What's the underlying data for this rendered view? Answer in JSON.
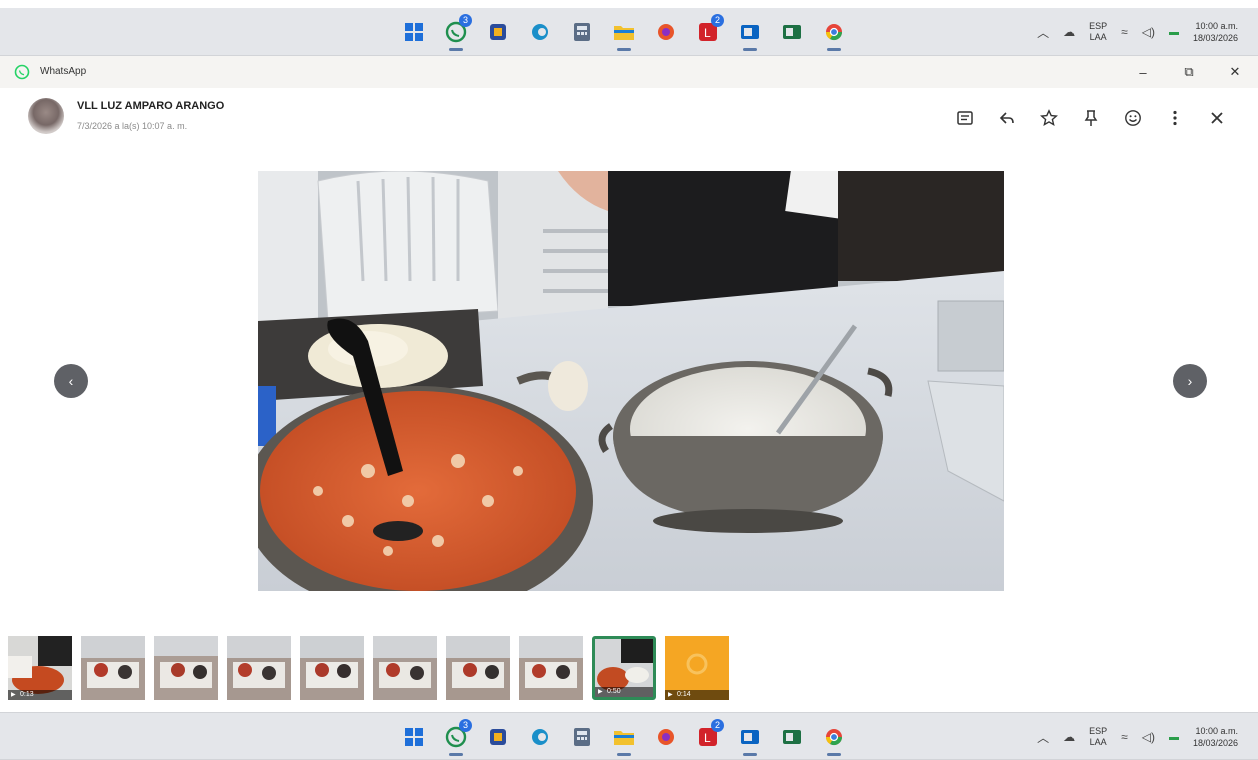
{
  "taskbar": {
    "apps": [
      {
        "icon": "windows-start-icon",
        "badge": "",
        "active": false
      },
      {
        "icon": "whatsapp-icon",
        "badge": "3",
        "active": true
      },
      {
        "icon": "store-app-icon",
        "badge": "",
        "active": false
      },
      {
        "icon": "edge-browser-icon",
        "badge": "",
        "active": false
      },
      {
        "icon": "calculator-icon",
        "badge": "",
        "active": false
      },
      {
        "icon": "file-explorer-icon",
        "badge": "",
        "active": true
      },
      {
        "icon": "firefox-icon",
        "badge": "",
        "active": false
      },
      {
        "icon": "red-app-icon",
        "badge": "2",
        "active": false
      },
      {
        "icon": "outlook-icon",
        "badge": "",
        "active": true
      },
      {
        "icon": "excel-icon",
        "badge": "",
        "active": false
      },
      {
        "icon": "chrome-icon",
        "badge": "",
        "active": true
      }
    ],
    "language": {
      "line1": "ESP",
      "line2": "LAA"
    },
    "clock": {
      "time": "10:00 a.m.",
      "date": "18/03/2026"
    }
  },
  "window": {
    "title": "WhatsApp",
    "minimize": "–",
    "restore": "⧉",
    "close": "✕"
  },
  "header": {
    "sender": "VLL LUZ AMPARO ARANGO",
    "timestamp": "7/3/2026 a la(s) 10:07 a. m."
  },
  "actions": [
    "open-in-chat-icon",
    "reply-icon",
    "star-icon",
    "pin-icon",
    "react-emoji-icon",
    "more-options-icon",
    "close-icon"
  ],
  "navigation": {
    "prev": "‹",
    "next": "›"
  },
  "thumbnails": [
    {
      "kind": "video",
      "duration": "0:13",
      "selected": false
    },
    {
      "kind": "photo",
      "duration": "",
      "selected": false
    },
    {
      "kind": "photo",
      "duration": "",
      "selected": false
    },
    {
      "kind": "photo",
      "duration": "",
      "selected": false
    },
    {
      "kind": "photo",
      "duration": "",
      "selected": false
    },
    {
      "kind": "photo",
      "duration": "",
      "selected": false
    },
    {
      "kind": "photo",
      "duration": "",
      "selected": false
    },
    {
      "kind": "photo",
      "duration": "",
      "selected": false
    },
    {
      "kind": "video",
      "duration": "0:50",
      "selected": true
    },
    {
      "kind": "video",
      "duration": "0:14",
      "selected": false
    }
  ],
  "colors": {
    "accent": "#2e8b57",
    "whatsapp": "#25d366",
    "nav": "#5f6166"
  }
}
